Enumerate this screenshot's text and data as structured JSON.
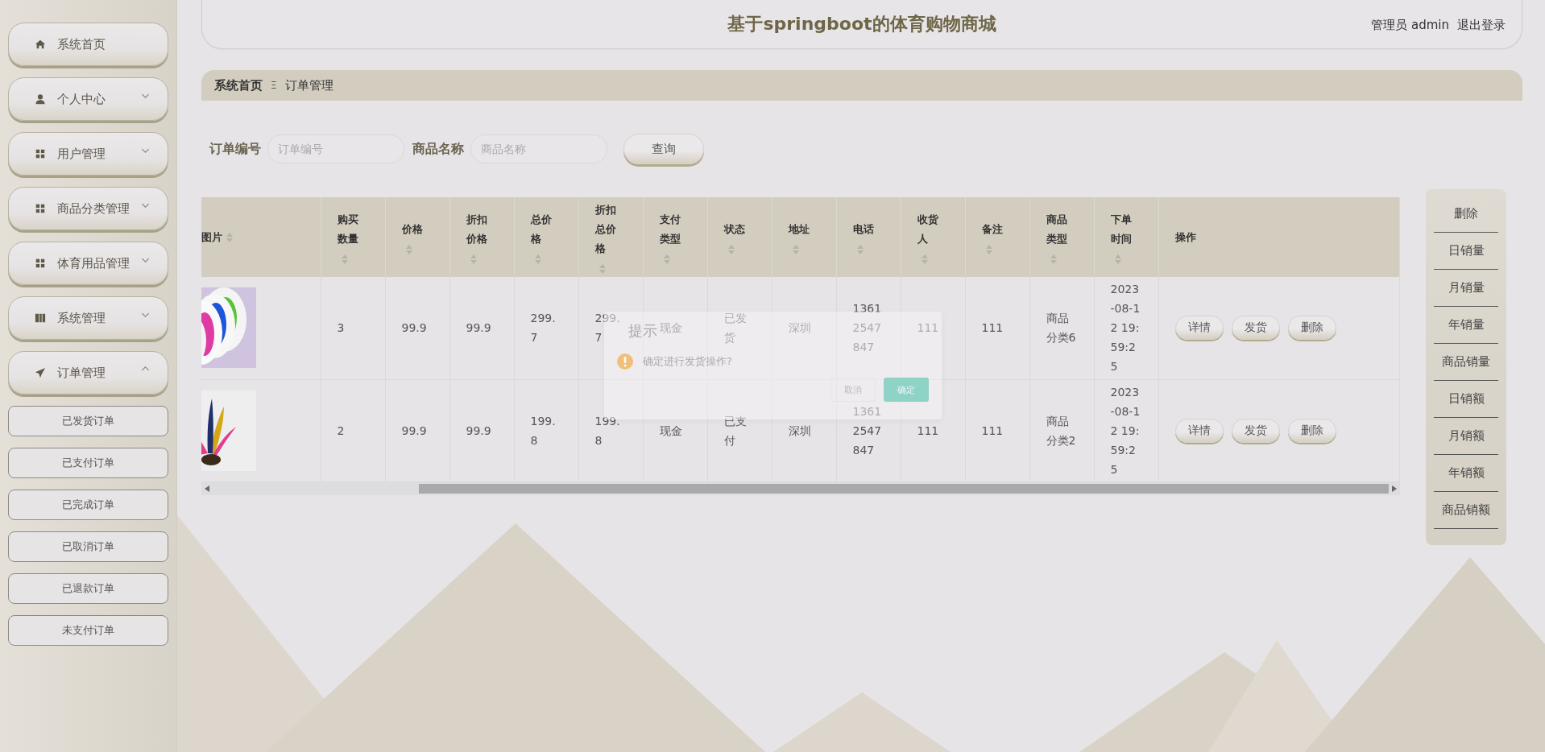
{
  "sidebar": {
    "home": {
      "label": "系统首页"
    },
    "menus": [
      {
        "label": "个人中心",
        "expanded": false
      },
      {
        "label": "用户管理",
        "expanded": false
      },
      {
        "label": "商品分类管理",
        "expanded": false
      },
      {
        "label": "体育用品管理",
        "expanded": false
      },
      {
        "label": "系统管理",
        "expanded": false
      },
      {
        "label": "订单管理",
        "expanded": true,
        "children": [
          {
            "label": "已发货订单"
          },
          {
            "label": "已支付订单"
          },
          {
            "label": "已完成订单"
          },
          {
            "label": "已取消订单"
          },
          {
            "label": "已退款订单"
          },
          {
            "label": "未支付订单"
          }
        ]
      }
    ]
  },
  "header": {
    "title": "基于springboot的体育购物商城",
    "user": "管理员 admin",
    "logout": "退出登录"
  },
  "breadcrumb": {
    "items": [
      "系统首页",
      "订单管理"
    ],
    "separator": "Ξ"
  },
  "search": {
    "fields": [
      {
        "label": "订单编号",
        "placeholder": "订单编号"
      },
      {
        "label": "商品名称",
        "placeholder": "商品名称"
      }
    ],
    "button": "查询"
  },
  "table": {
    "columns": [
      {
        "label": "图片",
        "sortable": true
      },
      {
        "label": "购买数量",
        "sortable": true
      },
      {
        "label": "价格",
        "sortable": true
      },
      {
        "label": "折扣价格",
        "sortable": true
      },
      {
        "label": "总价格",
        "sortable": true
      },
      {
        "label": "折扣总价格",
        "sortable": true
      },
      {
        "label": "支付类型",
        "sortable": true
      },
      {
        "label": "状态",
        "sortable": true
      },
      {
        "label": "地址",
        "sortable": true
      },
      {
        "label": "电话",
        "sortable": true
      },
      {
        "label": "收货人",
        "sortable": true
      },
      {
        "label": "备注",
        "sortable": true
      },
      {
        "label": "商品类型",
        "sortable": true
      },
      {
        "label": "下单时间",
        "sortable": true
      },
      {
        "label": "操作",
        "sortable": false
      }
    ],
    "rows": [
      {
        "cells": [
          {
            "kind": "picture"
          },
          "3",
          "99.9",
          "99.9",
          "299.7",
          "299.7",
          "现金",
          "已发货",
          "深圳",
          "13612547847",
          "111",
          "111",
          "商品分类6",
          "2023-08-12 19:59:25",
          {
            "actions": [
              "详情",
              "发货",
              "删除"
            ]
          }
        ]
      },
      {
        "cells": [
          {
            "kind": "picture"
          },
          "2",
          "99.9",
          "99.9",
          "199.8",
          "199.8",
          "现金",
          "已支付",
          "深圳",
          "13612547847",
          "111",
          "111",
          "商品分类2",
          "2023-08-12 19:59:25",
          {
            "actions": [
              "详情",
              "发货",
              "删除"
            ]
          }
        ]
      }
    ]
  },
  "side_panel": {
    "buttons": [
      "删除",
      "日销量",
      "月销量",
      "年销量",
      "商品销量",
      "日销额",
      "月销额",
      "年销额",
      "商品销额"
    ]
  },
  "dialog": {
    "title": "提示",
    "message": "确定进行发货操作?",
    "cancel": "取消",
    "confirm": "确定"
  }
}
